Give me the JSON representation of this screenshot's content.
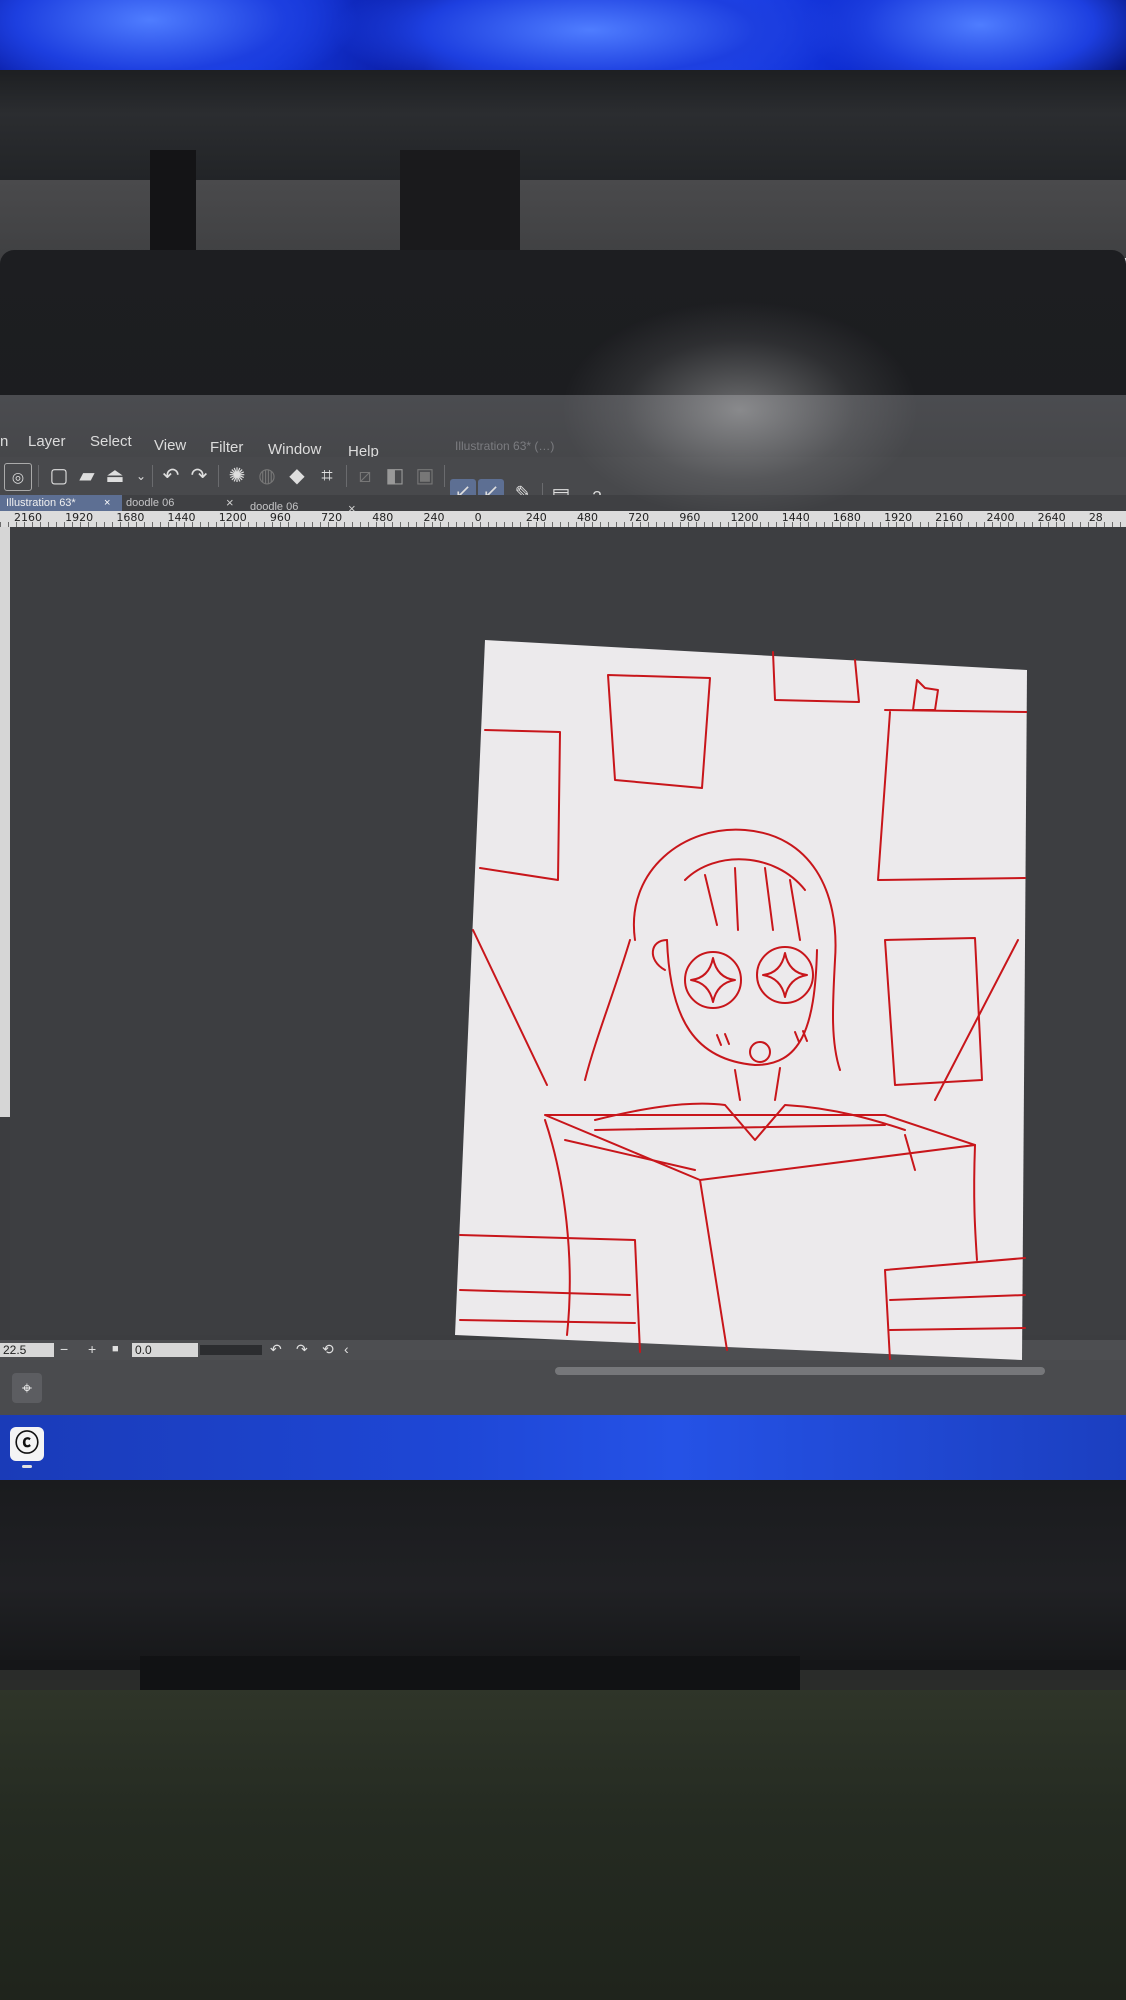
{
  "app": {
    "window_title": "Illustration 63* (…)"
  },
  "menu": {
    "items": [
      "n",
      "Layer",
      "Select",
      "View",
      "Filter",
      "Window",
      "Help"
    ]
  },
  "tabs": [
    {
      "label": "Illustration 63*",
      "active": true
    },
    {
      "label": "doodle 06",
      "active": false
    },
    {
      "label": "doodle 06",
      "active": false
    }
  ],
  "tab_close_glyph": "×",
  "ruler": {
    "labels": [
      "2160",
      "1920",
      "1680",
      "1440",
      "1200",
      "960",
      "720",
      "480",
      "240",
      "0",
      "240",
      "480",
      "720",
      "960",
      "1200",
      "1440",
      "1680",
      "1920",
      "2160",
      "2400",
      "2640",
      "28"
    ]
  },
  "statusbar": {
    "zoom": "22.5",
    "zoom_out": "−",
    "zoom_in": "+",
    "rotation": "0.0"
  },
  "toolbar": {
    "icons": [
      "new-canvas-icon",
      "open-file-icon",
      "save-icon",
      "undo-icon",
      "redo-icon",
      "loading-icon",
      "transform-icon",
      "crop-icon",
      "snap-ruler-icon",
      "snap-special-ruler-icon",
      "snap-grid-icon",
      "pen-active-icon",
      "pen-alt-icon",
      "edit-icon",
      "page-icon",
      "help-icon"
    ]
  },
  "panel": {
    "navigator_icon": "navigator-icon"
  },
  "taskbar": {
    "app_icon": "clip-studio-icon"
  },
  "colors": {
    "sketch_red": "#c8161b",
    "accent_blue": "#5d6f93",
    "taskbar_blue": "#1e47d6",
    "canvas_bg": "#3d3e41"
  },
  "canvas": {
    "subject": "red line sketch of a girl with sparkling eyes reading a book"
  }
}
